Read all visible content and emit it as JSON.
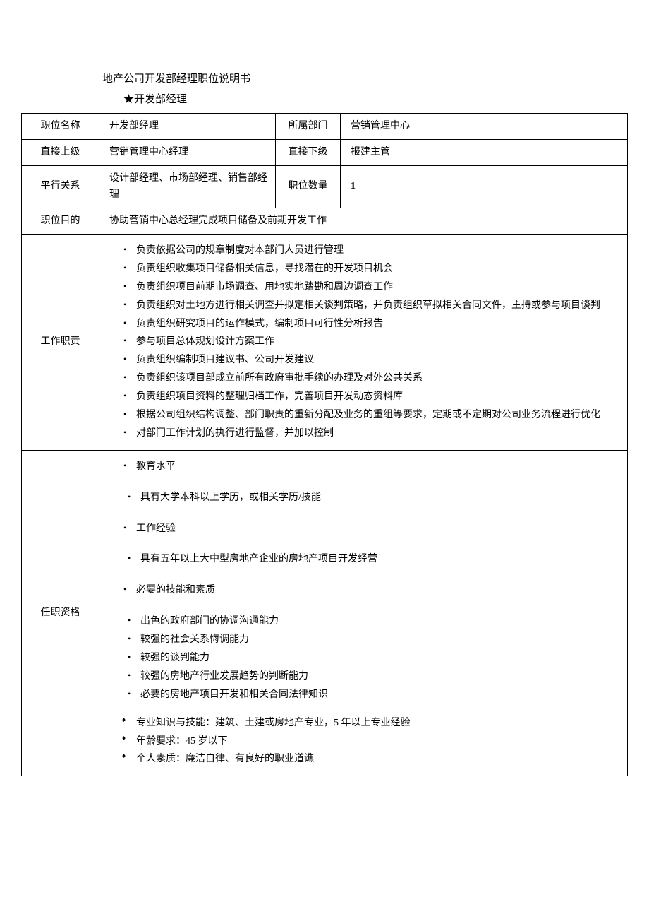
{
  "header": {
    "title": "地产公司开发部经理职位说明书",
    "subtitle": "★开发部经理"
  },
  "table": {
    "row1": {
      "label1": "职位名称",
      "value1": "开发部经理",
      "label2": "所属部门",
      "value2_bold": "营销管",
      "value2_rest": "理中心"
    },
    "row2": {
      "label1": "直接上级",
      "value1": "营销管理中心经理",
      "label2": "直接下级",
      "value2": "报建主管"
    },
    "row3": {
      "label1": "平行关系",
      "value1": "设计部经理、市场部经理、销售部经理",
      "label2": "职位数量",
      "value2": "1"
    },
    "row4": {
      "label": "职位目的",
      "value": "协助营销中心总经理完成项目储备及前期开发工作"
    },
    "duties": {
      "label": "工作职责",
      "items": [
        "负责依据公司的规章制度对本部门人员进行管理",
        "负责组织收集项目储备相关信息，寻找潜在的开发项目机会",
        "负责组织项目前期市场调查、用地实地踏勘和周边调查工作",
        "负责组织对土地方进行相关调查并拟定相关谈判策略，并负责组织草拟相关合同文件，主持或参与项目谈判",
        "负责组织研究项目的运作模式，编制项目可行性分析报告",
        "参与项目总体规划设计方案工作",
        "负责组织编制项目建议书、公司开发建议",
        "负责组织该项目部成立前所有政府审批手续的办理及对外公共关系",
        "负责组织项目资料的整理归档工作，完善项目开发动态资料库",
        "根据公司组织结构调整、部门职责的重新分配及业务的重组等要求，定期或不定期对公司业务流程进行优化",
        "对部门工作计划的执行进行监督，并加以控制"
      ]
    },
    "qualifications": {
      "label": "任职资格",
      "groups": [
        {
          "head": "教育水平",
          "subs": [
            "具有大学本科以上学历，或相关学历/技能"
          ]
        },
        {
          "head": "工作经验",
          "subs": [
            "具有五年以上大中型房地产企业的房地产项目开发经营"
          ]
        },
        {
          "head": "必要的技能和素质",
          "subs": [
            "出色的政府部门的协调沟通能力",
            "较强的社会关系悔调能力",
            "较强的谈判能力",
            "较强的房地产行业发展趋势的判断能力",
            "必要的房地产项目开发和相关合同法律知识"
          ]
        }
      ],
      "diamonds": [
        "专业知识与技能：建筑、土建或房地产专业，5 年以上专业经验",
        "年龄要求：45 岁以下",
        "个人素质：廉洁自律、有良好的职业道谯"
      ]
    }
  }
}
